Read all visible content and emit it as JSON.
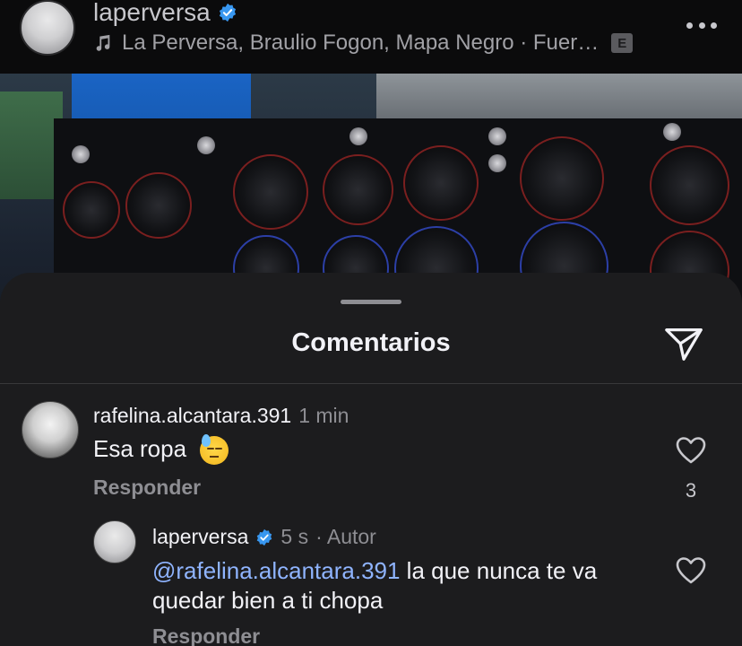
{
  "post": {
    "username": "laperversa",
    "audio": "La Perversa, Braulio Fogon, Mapa Negro · Fuer…",
    "explicit_badge": "E"
  },
  "sheet": {
    "title": "Comentarios"
  },
  "comments": [
    {
      "username": "rafelina.alcantara.391",
      "time": "1 min",
      "text": "Esa ropa",
      "emoji": "downcast-face-with-sweat",
      "reply_label": "Responder",
      "likes": "3"
    }
  ],
  "replies": [
    {
      "username": "laperversa",
      "time": "5 s",
      "author_label": "· Autor",
      "mention": "@rafelina.alcantara.391",
      "text": " la que nunca te va quedar bien a ti chopa",
      "reply_label": "Responder"
    }
  ],
  "colors": {
    "sheet_bg": "#1c1c1e",
    "verified_blue": "#3897f0",
    "mention_blue": "#8fb4ff",
    "secondary_text": "#8e8e93"
  },
  "icons": {
    "verified": "verified-badge-icon",
    "music": "music-note-icon",
    "more": "more-dots-icon",
    "send": "send-paper-plane-icon",
    "like": "heart-icon"
  }
}
